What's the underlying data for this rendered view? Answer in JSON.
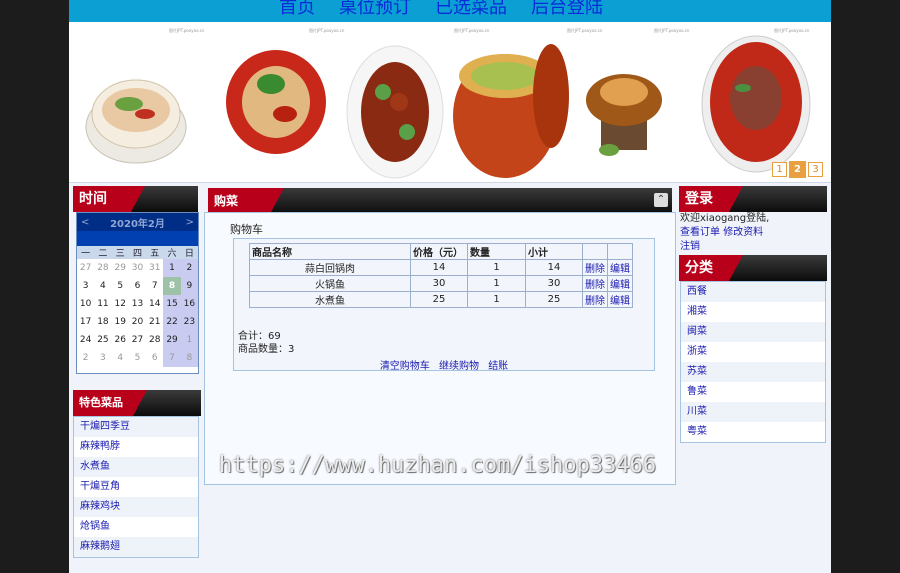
{
  "nav": {
    "items": [
      "首页",
      "桌位预订",
      "已选菜品",
      "后台登陆"
    ]
  },
  "banner": {
    "pages": [
      "1",
      "2",
      "3"
    ],
    "active_page": "2",
    "watermark_text": "图片JPT.pooyoo.cn"
  },
  "sections": {
    "time": "时间",
    "cart": "购菜",
    "featured": "特色菜品",
    "login": "登录",
    "category": "分类"
  },
  "calendar": {
    "prev": "<",
    "month": "2020年2月",
    "next": ">",
    "weekdays": [
      "一",
      "二",
      "三",
      "四",
      "五",
      "六",
      "日"
    ],
    "weeks": [
      [
        "27",
        "28",
        "29",
        "30",
        "31",
        "1",
        "2"
      ],
      [
        "3",
        "4",
        "5",
        "6",
        "7",
        "8",
        "9"
      ],
      [
        "10",
        "11",
        "12",
        "13",
        "14",
        "15",
        "16"
      ],
      [
        "17",
        "18",
        "19",
        "20",
        "21",
        "22",
        "23"
      ],
      [
        "24",
        "25",
        "26",
        "27",
        "28",
        "29",
        "1"
      ],
      [
        "2",
        "3",
        "4",
        "5",
        "6",
        "7",
        "8"
      ]
    ],
    "today": "8"
  },
  "featured_dishes": [
    "干煸四季豆",
    "麻辣鸭脖",
    "水煮鱼",
    "干煸豆角",
    "麻辣鸡块",
    "炝锅鱼",
    "麻辣鹅翅"
  ],
  "cart": {
    "title": "购物车",
    "headers": [
      "商品名称",
      "价格（元）",
      "数量",
      "小计",
      "",
      ""
    ],
    "rows": [
      {
        "name": "蒜白回锅肉",
        "price": "14",
        "qty": "1",
        "subtotal": "14",
        "delete": "删除",
        "edit": "编辑"
      },
      {
        "name": "火锅鱼",
        "price": "30",
        "qty": "1",
        "subtotal": "30",
        "delete": "删除",
        "edit": "编辑"
      },
      {
        "name": "水煮鱼",
        "price": "25",
        "qty": "1",
        "subtotal": "25",
        "delete": "删除",
        "edit": "编辑"
      }
    ],
    "total": "合计：69",
    "count": "商品数量：3",
    "links": [
      "清空购物车",
      "继续购物",
      "结账"
    ]
  },
  "login": {
    "welcome": "欢迎xiaogang登陆,",
    "view_orders": "查看订单",
    "edit_profile": "修改资料",
    "logout": "注销"
  },
  "categories": [
    "西餐",
    "湘菜",
    "闽菜",
    "浙菜",
    "苏菜",
    "鲁菜",
    "川菜",
    "粤菜"
  ],
  "page_watermark": "https://www.huzhan.com/ishop33466",
  "colors": {
    "nav_bg": "#0b9fd4",
    "nav_text": "#0a2bd8",
    "header_red": "#b8001a",
    "link_blue": "#1a1ab0",
    "pager_orange": "#e8a040"
  }
}
